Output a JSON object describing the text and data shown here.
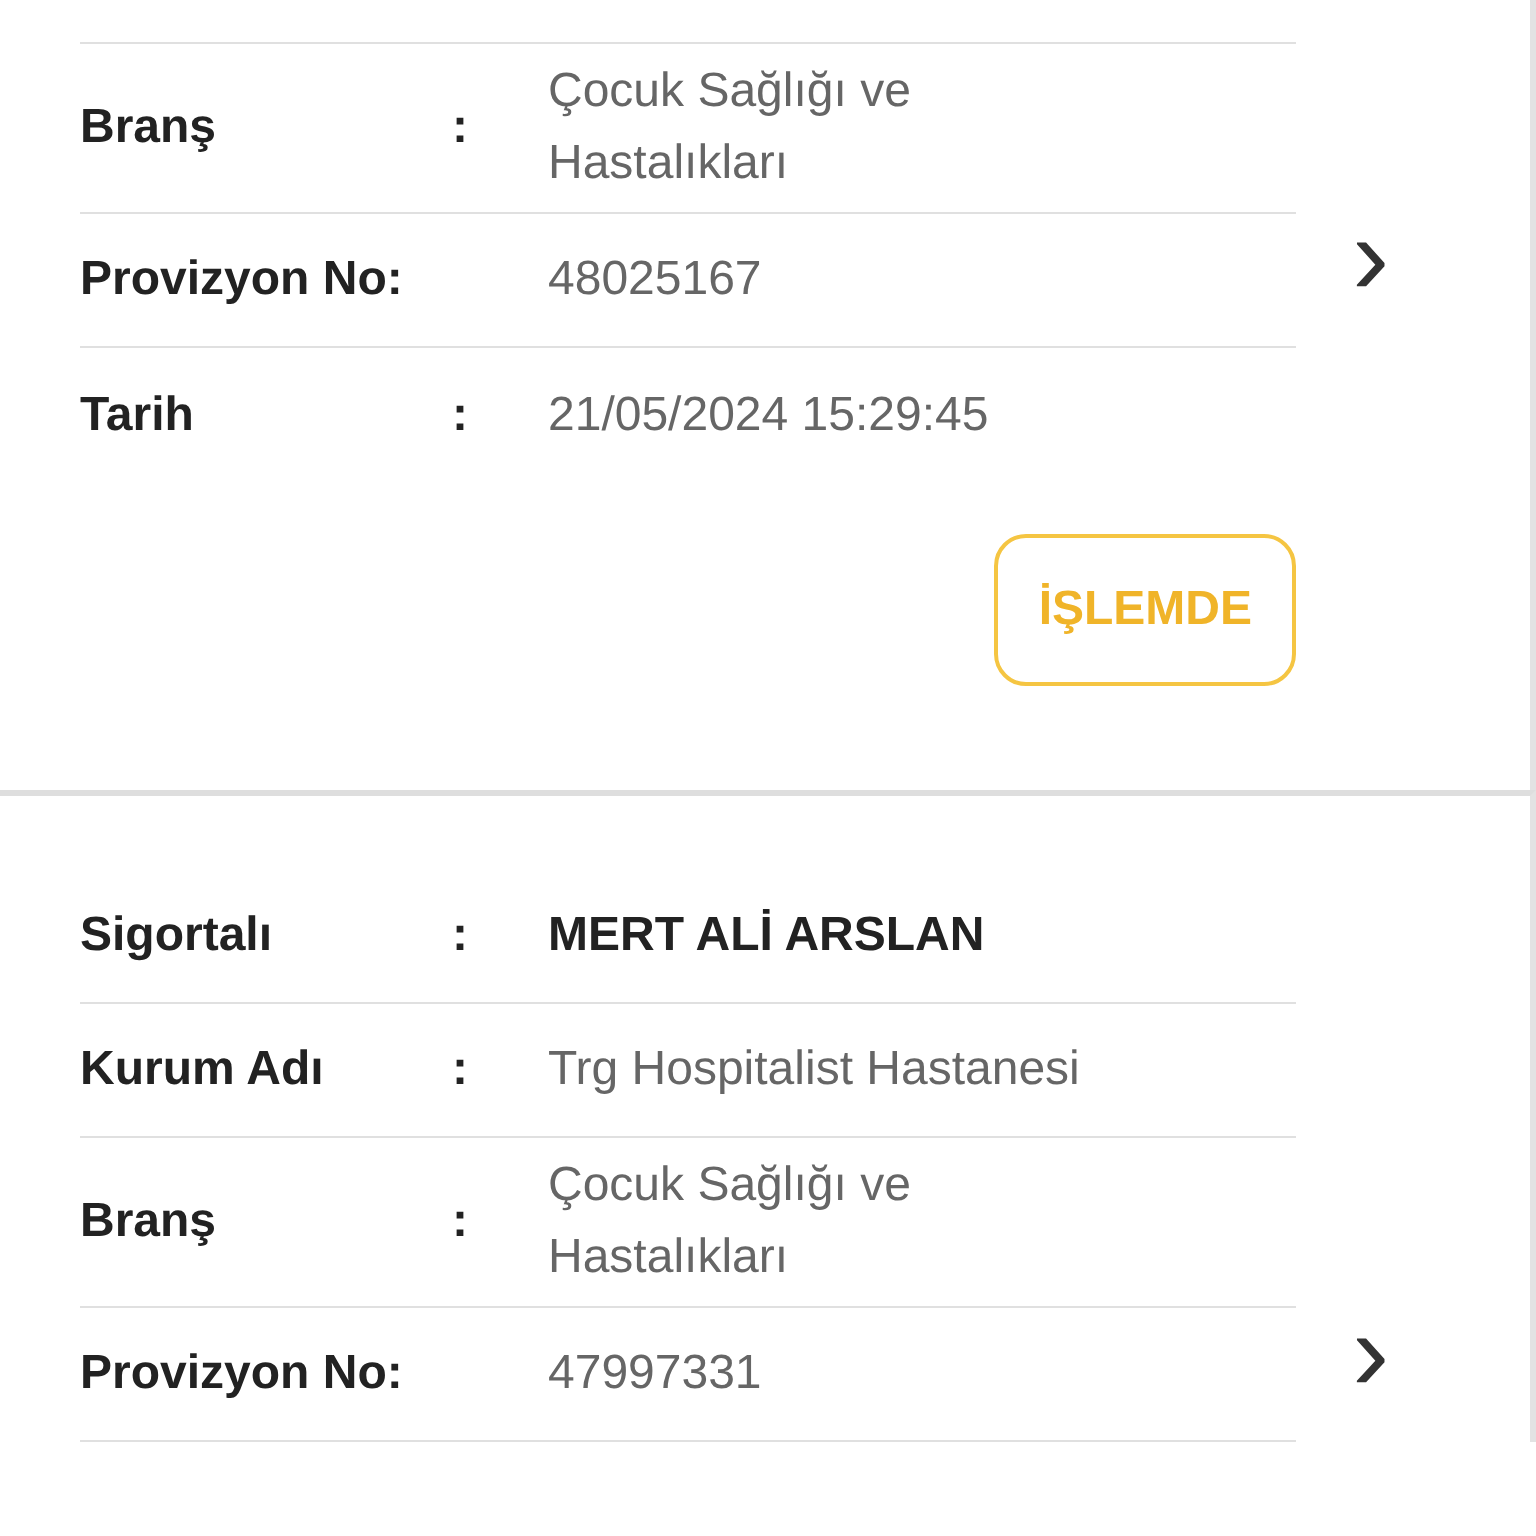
{
  "cards": [
    {
      "fields": [
        {
          "label": "Branş",
          "colon": ":",
          "value": "Çocuk Sağlığı ve\nHastalıkları",
          "kind": "text"
        },
        {
          "label": "Provizyon No:",
          "value": "48025167",
          "kind": "text"
        },
        {
          "label": "Tarih",
          "colon": ":",
          "value": "21/05/2024 15:29:45",
          "kind": "text"
        }
      ],
      "status": {
        "label": "İŞLEMDE",
        "kind": "in_progress"
      },
      "chevron": "›"
    },
    {
      "fields": [
        {
          "label": "Sigortalı",
          "colon": ":",
          "value": "MERT ALİ ARSLAN",
          "kind": "name"
        },
        {
          "label": "Kurum Adı",
          "colon": ":",
          "value": "Trg Hospitalist Hastanesi",
          "kind": "text"
        },
        {
          "label": "Branş",
          "colon": ":",
          "value": "Çocuk Sağlığı ve\nHastalıkları",
          "kind": "text"
        },
        {
          "label": "Provizyon No:",
          "value": "47997331",
          "kind": "text"
        }
      ],
      "chevron": "›"
    }
  ]
}
